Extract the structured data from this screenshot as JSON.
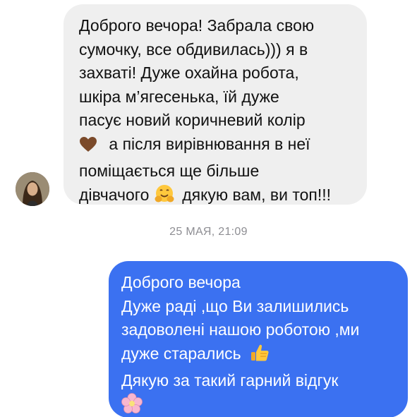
{
  "conversation": {
    "incoming": {
      "lines": [
        "Доброго вечора! Забрала свою",
        "сумочку, все обдивилась))) я в",
        "захваті! Дуже охайна робота,",
        "шкіра м’ягесенька, їй дуже",
        "пасує новий коричневий колір",
        "а після вирівнювання в неї",
        "поміщається ще більше",
        "дівчачого",
        "дякую вам, ви топ!!!"
      ],
      "emojis": [
        "brown-heart",
        "hugging-face"
      ]
    },
    "timestamp": "25 МАЯ, 21:09",
    "outgoing": {
      "lines": [
        "Доброго вечора",
        "Дуже раді ,що Ви залишились",
        "задоволені нашою роботою ,ми",
        "дуже старались",
        "Дякую за такий гарний відгук"
      ],
      "emojis": [
        "thumbs-up",
        "cherry-blossom"
      ]
    }
  },
  "colors": {
    "incoming_bubble": "#efefef",
    "outgoing_bubble": "#3b71f1",
    "timestamp_text": "#8e8e93"
  }
}
